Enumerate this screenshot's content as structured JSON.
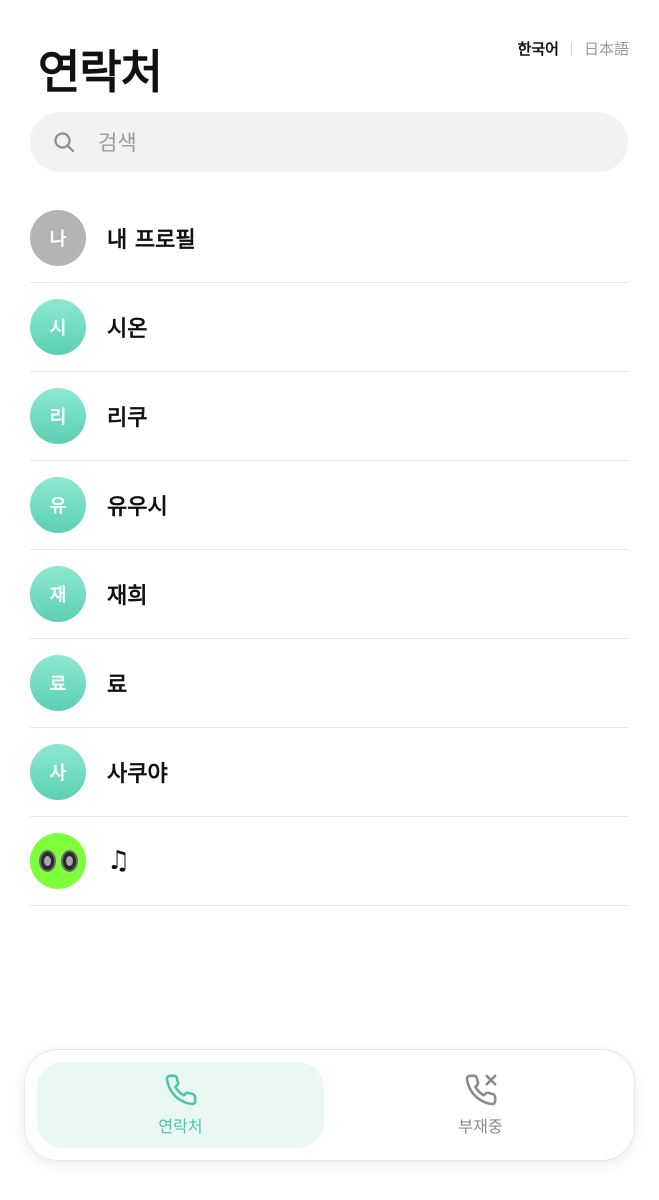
{
  "header": {
    "title": "연락처",
    "lang_active": "한국어",
    "lang_other": "日本語"
  },
  "search": {
    "placeholder": "검색",
    "icon": "search-icon"
  },
  "contacts": [
    {
      "initial": "나",
      "name": "내 프로필",
      "avatar_style": "gray"
    },
    {
      "initial": "시",
      "name": "시온",
      "avatar_style": "mint"
    },
    {
      "initial": "리",
      "name": "리쿠",
      "avatar_style": "mint"
    },
    {
      "initial": "유",
      "name": "유우시",
      "avatar_style": "mint"
    },
    {
      "initial": "재",
      "name": "재희",
      "avatar_style": "mint"
    },
    {
      "initial": "료",
      "name": "료",
      "avatar_style": "mint"
    },
    {
      "initial": "사",
      "name": "사쿠야",
      "avatar_style": "mint"
    },
    {
      "initial": "",
      "name": "♫",
      "avatar_style": "green-face-image"
    }
  ],
  "tabbar": {
    "contacts_label": "연락처",
    "missed_label": "부재중",
    "contacts_icon": "phone-icon",
    "missed_icon": "phone-missed-icon"
  },
  "colors": {
    "accent": "#5cd0b4",
    "accent_bg": "#e9f8f3",
    "profile_avatar": "#b4b4b4",
    "image_avatar": "#7dff3a"
  }
}
